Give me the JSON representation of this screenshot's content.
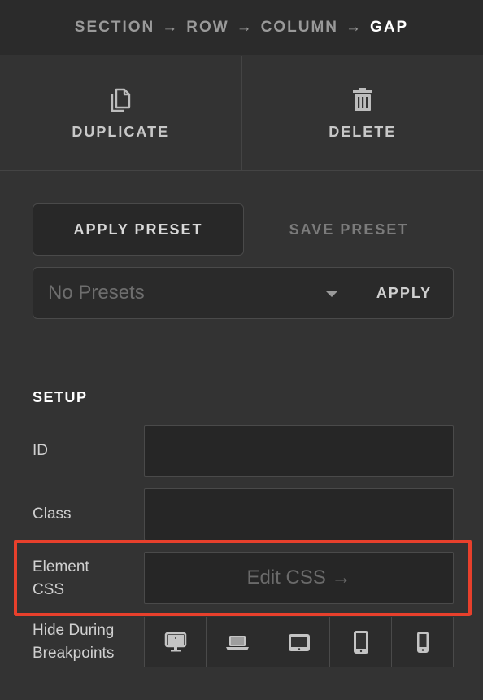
{
  "breadcrumb": {
    "items": [
      "SECTION",
      "ROW",
      "COLUMN"
    ],
    "current": "GAP",
    "separator": "→"
  },
  "actions": {
    "duplicate_label": "DUPLICATE",
    "duplicate_icon": "duplicate-icon",
    "delete_label": "DELETE",
    "delete_icon": "trash-icon"
  },
  "presets": {
    "apply_tab": "APPLY PRESET",
    "save_tab": "SAVE PRESET",
    "active_tab": "APPLY PRESET",
    "select_value": "No Presets",
    "apply_button": "APPLY"
  },
  "setup": {
    "title": "SETUP",
    "id_label": "ID",
    "id_value": "",
    "class_label": "Class",
    "class_value": "",
    "element_css_label_line1": "Element",
    "element_css_label_line2": "CSS",
    "edit_css_button": "Edit CSS →",
    "hide_label_line1": "Hide During",
    "hide_label_line2": "Breakpoints",
    "breakpoints": [
      {
        "name": "desktop",
        "icon": "desktop-icon"
      },
      {
        "name": "laptop",
        "icon": "laptop-icon"
      },
      {
        "name": "tablet-landscape",
        "icon": "tablet-landscape-icon"
      },
      {
        "name": "tablet-portrait",
        "icon": "tablet-portrait-icon"
      },
      {
        "name": "phone",
        "icon": "phone-icon"
      }
    ]
  },
  "colors": {
    "background": "#333333",
    "highlight": "#e8402c"
  }
}
